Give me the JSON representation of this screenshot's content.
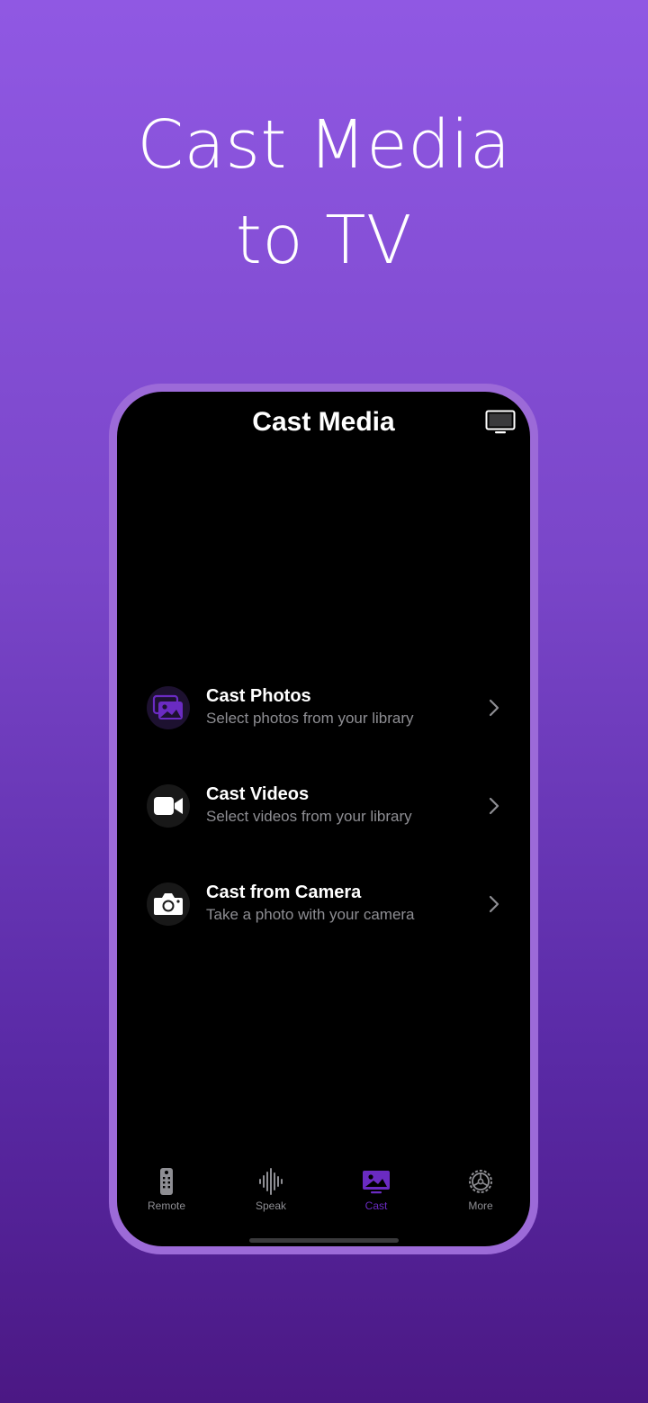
{
  "headline": {
    "line1": "Cast Media",
    "line2": "to TV"
  },
  "screen": {
    "title": "Cast Media",
    "tv_button_icon": "tv-icon"
  },
  "menu": [
    {
      "title": "Cast Photos",
      "subtitle": "Select photos from your library",
      "icon": "photo-library-icon"
    },
    {
      "title": "Cast Videos",
      "subtitle": "Select videos from your library",
      "icon": "video-camera-icon"
    },
    {
      "title": "Cast from Camera",
      "subtitle": "Take a photo with your camera",
      "icon": "camera-icon"
    }
  ],
  "tabbar": {
    "items": [
      {
        "label": "Remote",
        "icon": "remote-icon",
        "active": false
      },
      {
        "label": "Speak",
        "icon": "waveform-icon",
        "active": false
      },
      {
        "label": "Cast",
        "icon": "cast-photo-icon",
        "active": true
      },
      {
        "label": "More",
        "icon": "gear-icon",
        "active": false
      }
    ]
  },
  "colors": {
    "accent": "#6a2bc2",
    "background_top": "#9058e3",
    "background_bottom": "#4b1884",
    "secondary_text": "#8e8e93"
  }
}
